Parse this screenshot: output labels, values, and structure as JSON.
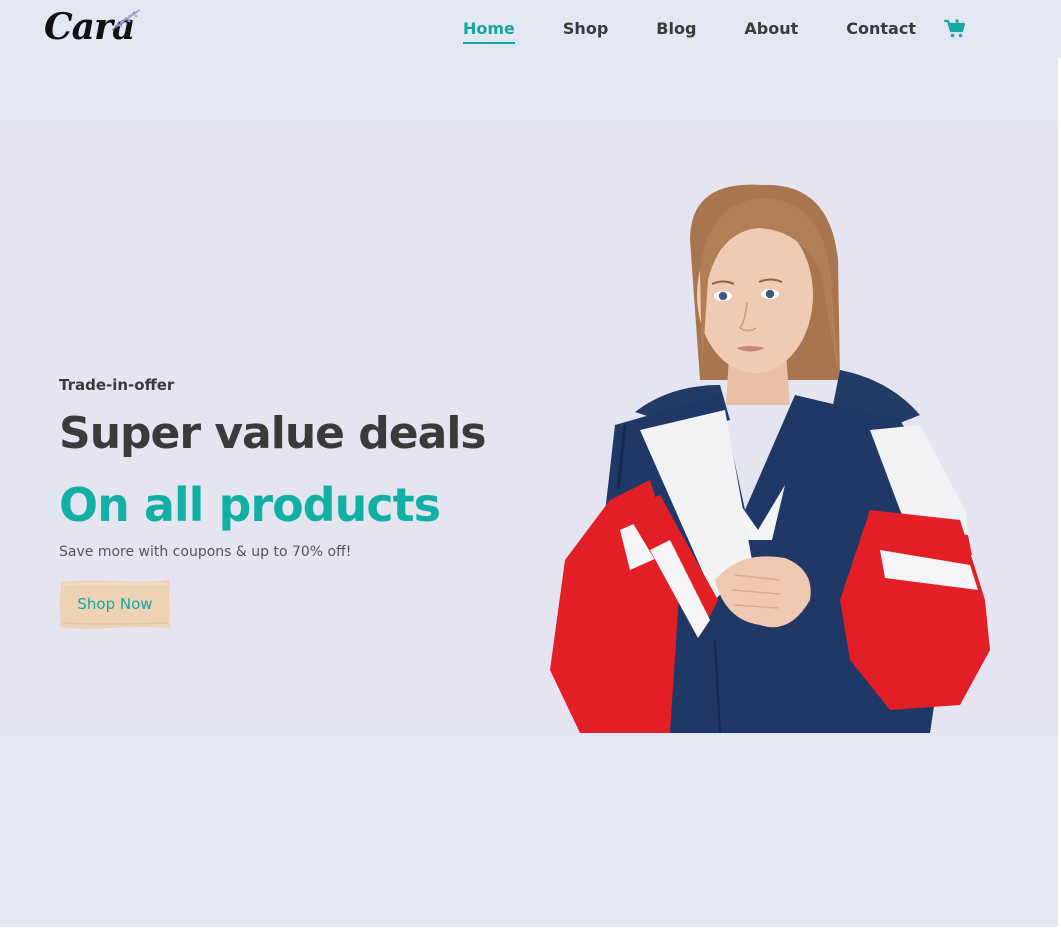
{
  "brand": {
    "logo_text": "Cara"
  },
  "nav": {
    "items": [
      {
        "label": "Home",
        "active": true
      },
      {
        "label": "Shop",
        "active": false
      },
      {
        "label": "Blog",
        "active": false
      },
      {
        "label": "About",
        "active": false
      },
      {
        "label": "Contact",
        "active": false
      }
    ],
    "cart_icon": "shopping-cart-icon"
  },
  "hero": {
    "eyebrow": "Trade-in-offer",
    "heading": "Super value deals",
    "heading_accent": "On all products",
    "subtext": "Save more with coupons & up to 70% off!",
    "cta_label": "Shop Now",
    "image": "woman-in-red-white-navy-windbreaker"
  },
  "colors": {
    "background": "#e3e6f3",
    "accent": "#12b0a4",
    "text_dark": "#3a3a3a",
    "cta_background": "#eed2b6"
  }
}
